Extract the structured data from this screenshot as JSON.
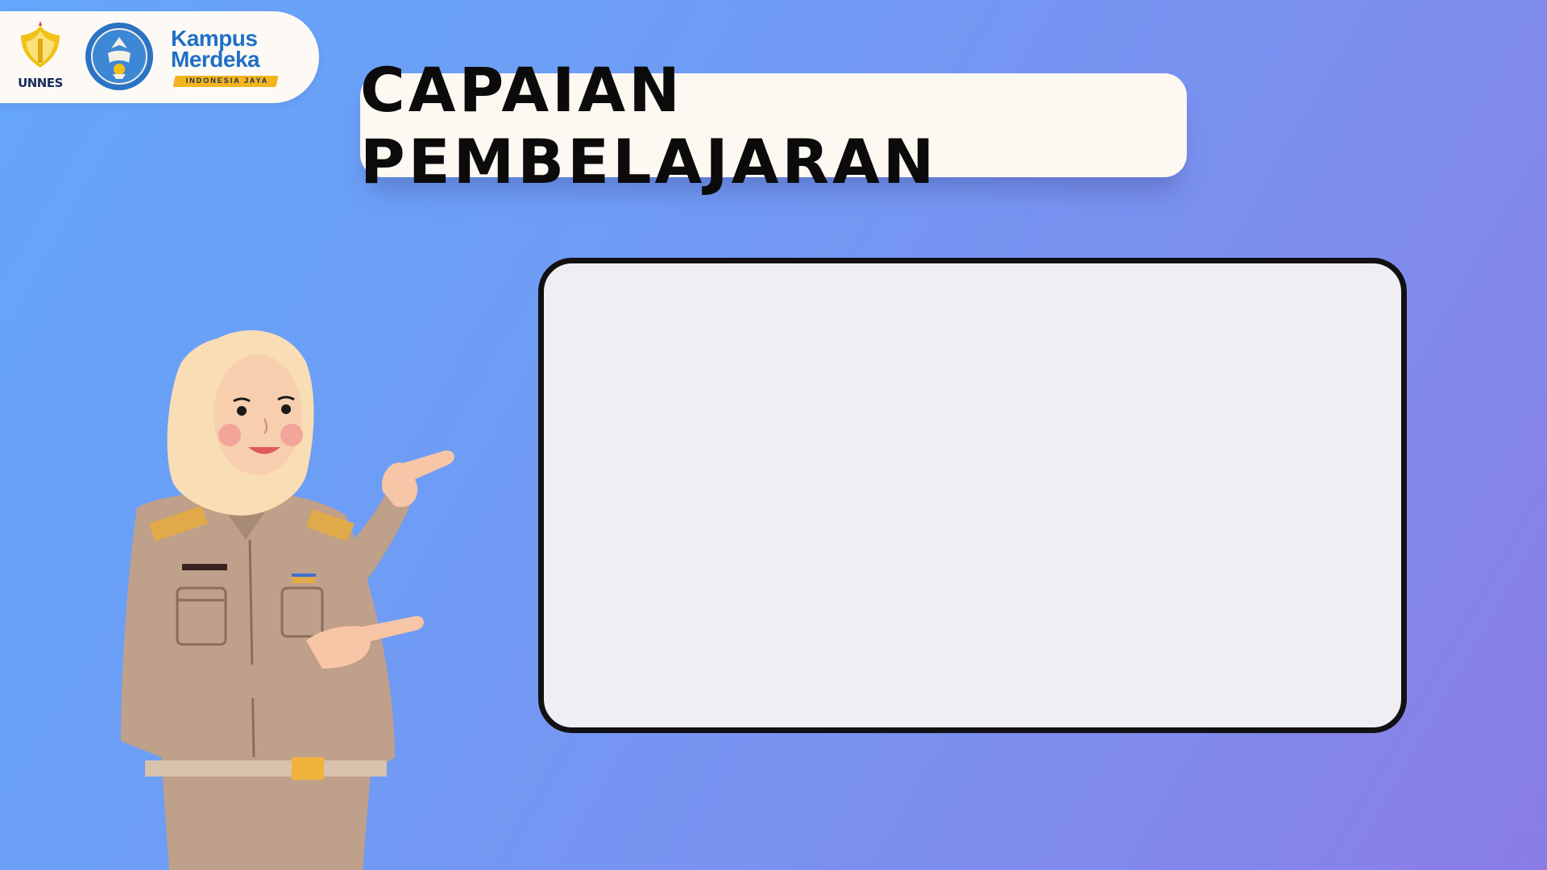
{
  "logos": {
    "unnes": {
      "text": "UNNES",
      "icon": "unnes-logo-icon"
    },
    "tut_wuri": {
      "icon": "tut-wuri-handayani-logo-icon"
    },
    "kampus_merdeka": {
      "line1": "Kampus",
      "line2": "Merdeka",
      "tagline": "INDONESIA JAYA",
      "icon": "kampus-merdeka-logo"
    }
  },
  "title": "CAPAIAN PEMBELAJARAN",
  "content_panel": {
    "text": ""
  },
  "illustration": {
    "icon": "teacher-pointing-illustration"
  },
  "colors": {
    "background_start": "#64a6fb",
    "background_end": "#8a7de6",
    "title_box": "#fdf8f1",
    "panel_fill": "#efeef2",
    "panel_border": "#111111"
  }
}
